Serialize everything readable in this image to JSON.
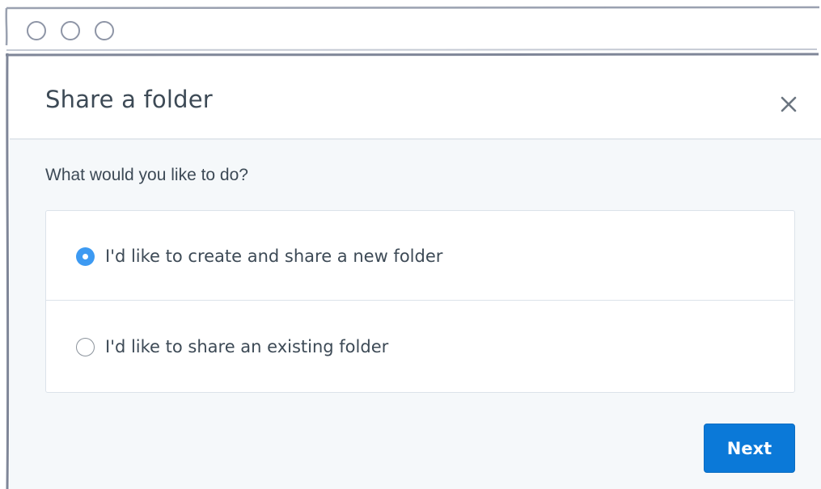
{
  "window": {
    "controls": [
      "close-dot",
      "minimize-dot",
      "maximize-dot"
    ]
  },
  "dialog": {
    "title": "Share a folder",
    "close_icon": "close-icon",
    "prompt": "What would you like to do?",
    "options": [
      {
        "label": "I'd like to create and share a new folder",
        "selected": true
      },
      {
        "label": "I'd like to share an existing folder",
        "selected": false
      }
    ],
    "next_label": "Next"
  },
  "colors": {
    "accent": "#0b79d8",
    "radio_selected": "#3d9af2",
    "text": "#3d4a56",
    "body_bg": "#f5f8fa",
    "chrome_stroke": "#8e95a6"
  }
}
